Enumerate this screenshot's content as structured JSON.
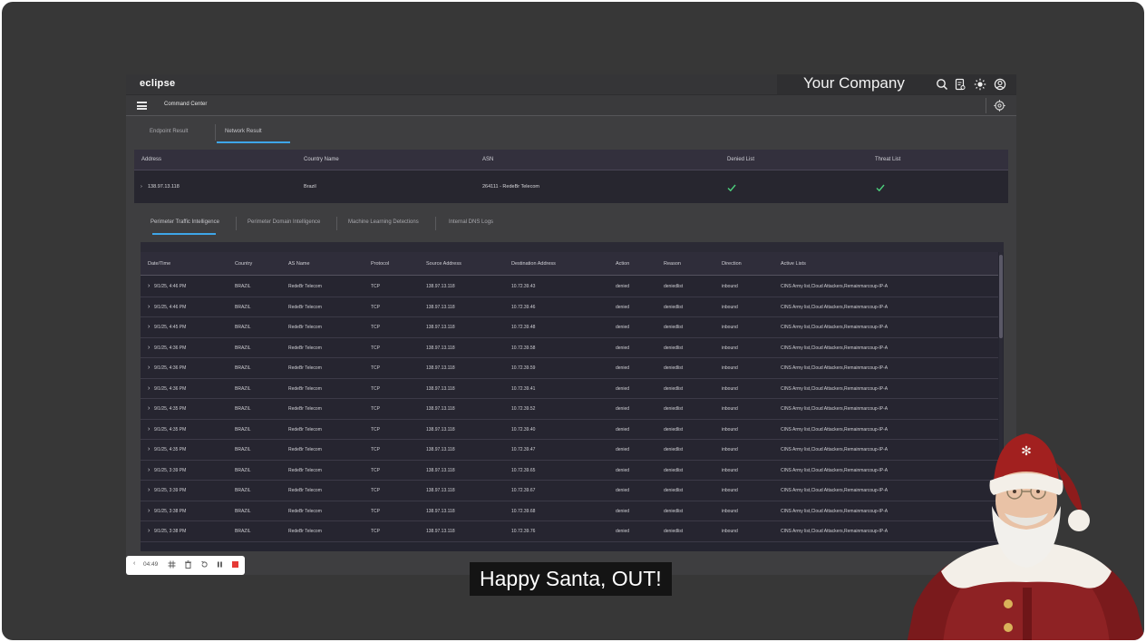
{
  "app": {
    "logo": "eclipse",
    "company_name": "Your Company",
    "command_title": "Command Center"
  },
  "icons": {
    "search": "search-icon",
    "report": "report-icon",
    "theme": "sun-icon",
    "account": "user-circle-icon",
    "target": "crosshair-icon",
    "menu": "hamburger-icon"
  },
  "result_tabs": [
    {
      "label": "Endpoint Result",
      "active": false
    },
    {
      "label": "Network Result",
      "active": true
    }
  ],
  "summary": {
    "columns": [
      "Address",
      "Country Name",
      "ASN",
      "Denied List",
      "Threat List"
    ],
    "row": {
      "address": "138.97.13.118",
      "country": "Brazil",
      "asn": "264111 - RedeBr Telecom",
      "denied": true,
      "threat": true
    }
  },
  "intel_tabs": [
    {
      "label": "Perimeter Traffic Intelligence",
      "active": true
    },
    {
      "label": "Perimeter Domain Intelligence",
      "active": false
    },
    {
      "label": "Machine Learning Detections",
      "active": false
    },
    {
      "label": "Internal DNS Logs",
      "active": false
    }
  ],
  "table": {
    "columns": [
      "Date/Time",
      "Country",
      "AS Name",
      "Protocol",
      "Source Address",
      "Destination Address",
      "Action",
      "Reason",
      "Direction",
      "Active Lists"
    ],
    "rows": [
      [
        "9/1/25, 4:46 PM",
        "BRAZIL",
        "RedeBr Telecom",
        "TCP",
        "138.97.13.118",
        "10.72.39.43",
        "denied",
        "deniedlist",
        "inbound",
        "CINS Army list,Cloud Attackers,Remainmarcoup-IP-A"
      ],
      [
        "9/1/25, 4:46 PM",
        "BRAZIL",
        "RedeBr Telecom",
        "TCP",
        "138.97.13.118",
        "10.72.39.46",
        "denied",
        "deniedlist",
        "inbound",
        "CINS Army list,Cloud Attackers,Remainmarcoup-IP-A"
      ],
      [
        "9/1/25, 4:45 PM",
        "BRAZIL",
        "RedeBr Telecom",
        "TCP",
        "138.97.13.118",
        "10.72.39.48",
        "denied",
        "deniedlist",
        "inbound",
        "CINS Army list,Cloud Attackers,Remainmarcoup-IP-A"
      ],
      [
        "9/1/25, 4:36 PM",
        "BRAZIL",
        "RedeBr Telecom",
        "TCP",
        "138.97.13.118",
        "10.72.39.58",
        "denied",
        "deniedlist",
        "inbound",
        "CINS Army list,Cloud Attackers,Remainmarcoup-IP-A"
      ],
      [
        "9/1/25, 4:36 PM",
        "BRAZIL",
        "RedeBr Telecom",
        "TCP",
        "138.97.13.118",
        "10.72.39.59",
        "denied",
        "deniedlist",
        "inbound",
        "CINS Army list,Cloud Attackers,Remainmarcoup-IP-A"
      ],
      [
        "9/1/25, 4:36 PM",
        "BRAZIL",
        "RedeBr Telecom",
        "TCP",
        "138.97.13.118",
        "10.72.39.41",
        "denied",
        "deniedlist",
        "inbound",
        "CINS Army list,Cloud Attackers,Remainmarcoup-IP-A"
      ],
      [
        "9/1/25, 4:35 PM",
        "BRAZIL",
        "RedeBr Telecom",
        "TCP",
        "138.97.13.118",
        "10.72.39.52",
        "denied",
        "deniedlist",
        "inbound",
        "CINS Army list,Cloud Attackers,Remainmarcoup-IP-A"
      ],
      [
        "9/1/25, 4:35 PM",
        "BRAZIL",
        "RedeBr Telecom",
        "TCP",
        "138.97.13.118",
        "10.72.39.40",
        "denied",
        "deniedlist",
        "inbound",
        "CINS Army list,Cloud Attackers,Remainmarcoup-IP-A"
      ],
      [
        "9/1/25, 4:35 PM",
        "BRAZIL",
        "RedeBr Telecom",
        "TCP",
        "138.97.13.118",
        "10.72.39.47",
        "denied",
        "deniedlist",
        "inbound",
        "CINS Army list,Cloud Attackers,Remainmarcoup-IP-A"
      ],
      [
        "9/1/25, 3:39 PM",
        "BRAZIL",
        "RedeBr Telecom",
        "TCP",
        "138.97.13.118",
        "10.72.39.65",
        "denied",
        "deniedlist",
        "inbound",
        "CINS Army list,Cloud Attackers,Remainmarcoup-IP-A"
      ],
      [
        "9/1/25, 3:39 PM",
        "BRAZIL",
        "RedeBr Telecom",
        "TCP",
        "138.97.13.118",
        "10.72.39.67",
        "denied",
        "deniedlist",
        "inbound",
        "CINS Army list,Cloud Attackers,Remainmarcoup-IP-A"
      ],
      [
        "9/1/25, 3:38 PM",
        "BRAZIL",
        "RedeBr Telecom",
        "TCP",
        "138.97.13.118",
        "10.72.39.68",
        "denied",
        "deniedlist",
        "inbound",
        "CINS Army list,Cloud Attackers,Remainmarcoup-IP-A"
      ],
      [
        "9/1/25, 3:38 PM",
        "BRAZIL",
        "RedeBr Telecom",
        "TCP",
        "138.97.13.118",
        "10.72.39.76",
        "denied",
        "deniedlist",
        "inbound",
        "CINS Army list,Cloud Attackers,Remainmarcoup-IP-A"
      ]
    ]
  },
  "recorder": {
    "back": "‹",
    "time": "04:49"
  },
  "caption": "Happy Santa, OUT!",
  "colors": {
    "accent": "#3ea6e8",
    "check": "#4cd07d",
    "stop": "#e53935"
  }
}
